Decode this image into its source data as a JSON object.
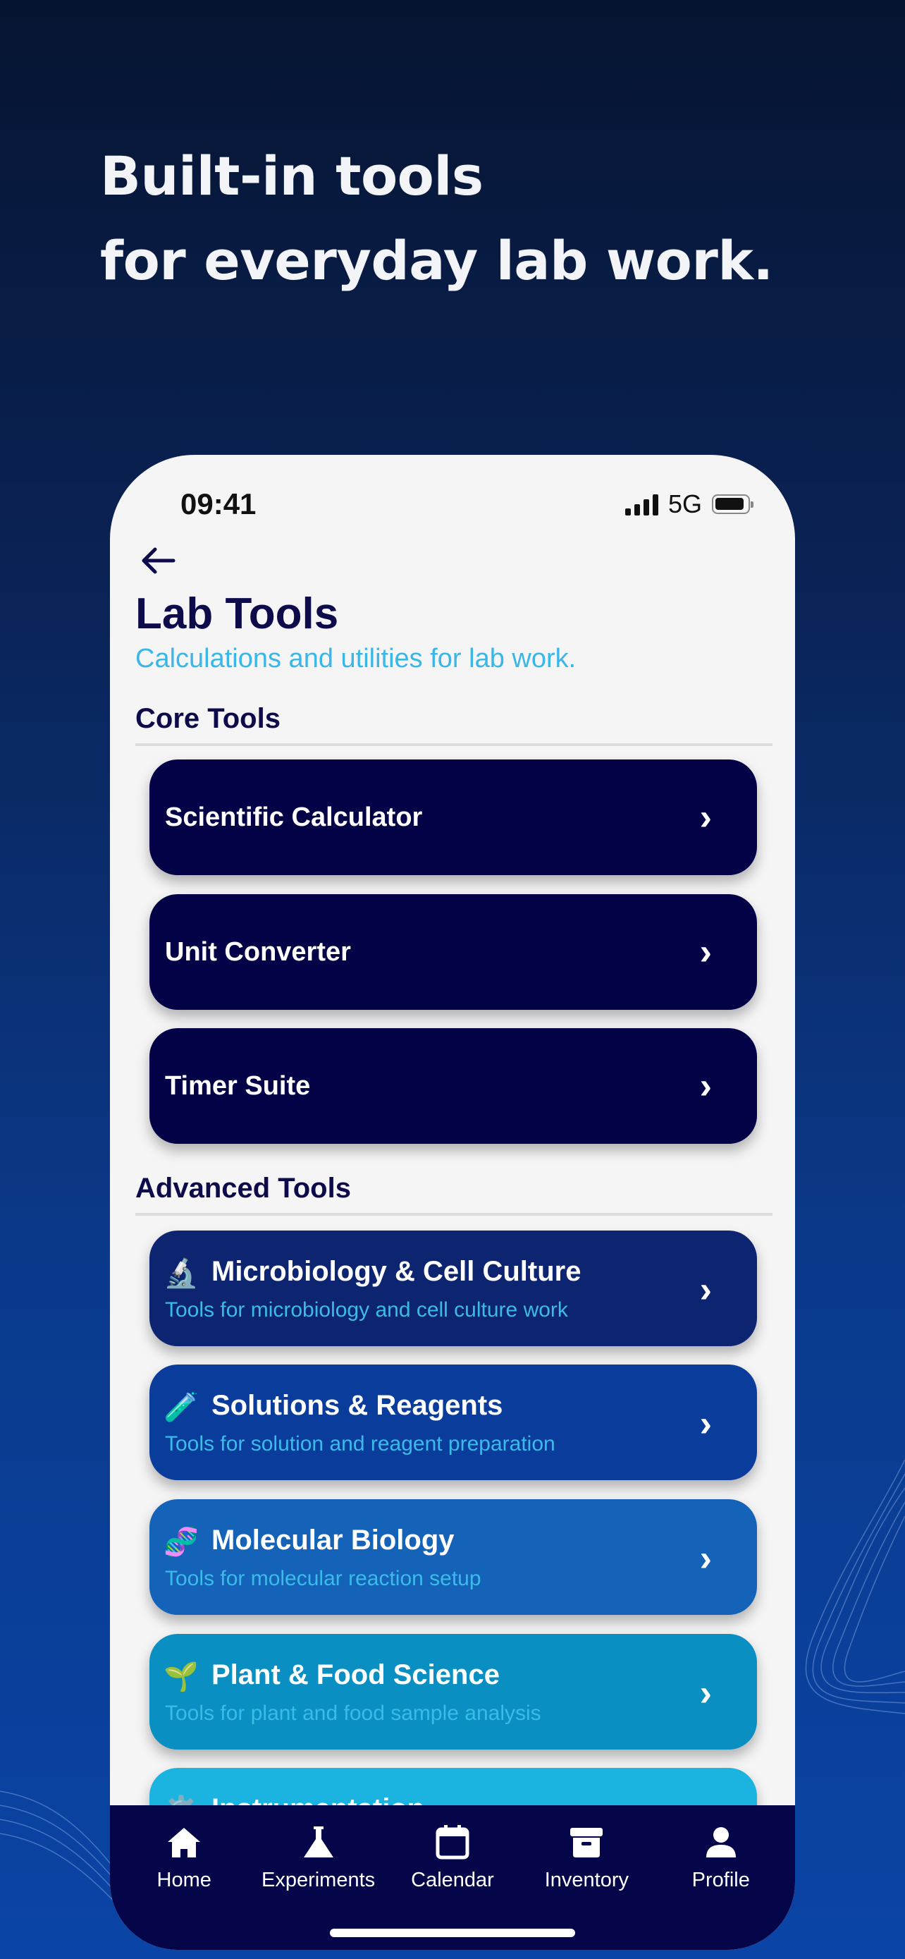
{
  "headline": {
    "line1": "Built-in tools",
    "line2": "for everyday lab work."
  },
  "status_bar": {
    "time": "09:41",
    "network": "5G"
  },
  "page": {
    "title": "Lab Tools",
    "subtitle": "Calculations and utilities for lab work."
  },
  "sections": {
    "core": {
      "title": "Core Tools",
      "items": [
        {
          "label": "Scientific Calculator"
        },
        {
          "label": "Unit Converter"
        },
        {
          "label": "Timer Suite"
        }
      ]
    },
    "advanced": {
      "title": "Advanced Tools",
      "items": [
        {
          "icon": "microscope-icon",
          "emoji": "🔬",
          "title": "Microbiology & Cell Culture",
          "description": "Tools for microbiology and cell culture work",
          "color": "#0d2470"
        },
        {
          "icon": "test-tube-icon",
          "emoji": "🧪",
          "title": "Solutions & Reagents",
          "description": "Tools for solution and reagent preparation",
          "color": "#0a3c9c"
        },
        {
          "icon": "dna-icon",
          "emoji": "🧬",
          "title": "Molecular Biology",
          "description": "Tools for molecular reaction setup",
          "color": "#1463b8"
        },
        {
          "icon": "seedling-icon",
          "emoji": "🌱",
          "title": "Plant & Food Science",
          "description": "Tools for plant and food sample analysis",
          "color": "#0a8fc2"
        },
        {
          "icon": "gear-icon",
          "emoji": "⚙️",
          "title": "Instrumentation",
          "description": "",
          "color": "#1bb4e0"
        }
      ]
    }
  },
  "tab_bar": {
    "items": [
      {
        "label": "Home",
        "icon": "home-icon"
      },
      {
        "label": "Experiments",
        "icon": "flask-icon"
      },
      {
        "label": "Calendar",
        "icon": "calendar-icon"
      },
      {
        "label": "Inventory",
        "icon": "archive-icon"
      },
      {
        "label": "Profile",
        "icon": "person-icon"
      }
    ]
  },
  "colors": {
    "navy": "#030246",
    "accent": "#3ab7e6",
    "tabbar": "#05054a"
  }
}
